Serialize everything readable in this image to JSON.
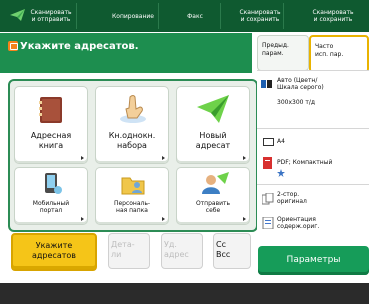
{
  "tabs": [
    {
      "label": "Сканировать\nи отправить"
    },
    {
      "label": "Копирование"
    },
    {
      "label": "Факс"
    },
    {
      "label": "Сканировать\nи сохранить"
    },
    {
      "label": "Сканировать\nи сохранить"
    }
  ],
  "header": {
    "title": "Укажите адресатов."
  },
  "grid": [
    {
      "label": "Адресная\nкнига"
    },
    {
      "label": "Кн.однокн.\nнабора"
    },
    {
      "label": "Новый\nадресат"
    },
    {
      "label": "Мобильный\nпортал"
    },
    {
      "label": "Персональ-\nная папка"
    },
    {
      "label": "Отправить\nсебе"
    }
  ],
  "bottom": {
    "specify_label": "Укажите\nадресатов",
    "detail_label": "Дета-\nли",
    "delete_label": "Уд.\nадрес",
    "cc_label": "Cc\nBcc"
  },
  "right": {
    "tab_prev": "Предыд.\nпарам.",
    "tab_freq": "Часто\nисп. пар.",
    "rows": [
      {
        "text": "Авто (Цветн/\nШкала серого)"
      },
      {
        "text": "300x300 т/д"
      },
      {
        "text": "A4"
      },
      {
        "text": "PDF; Компактный"
      },
      {
        "text": "2-стор.\nоригинал"
      },
      {
        "text": "Ориентация\nсодерж.ориг."
      }
    ],
    "params_label": "Параметры"
  }
}
